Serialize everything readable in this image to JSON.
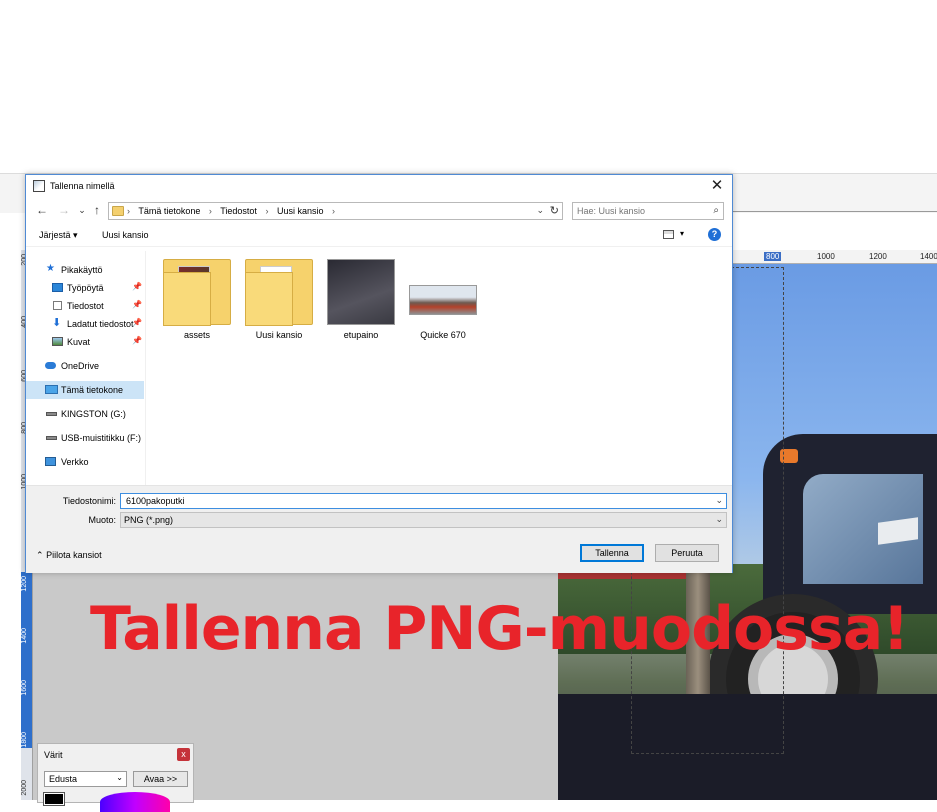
{
  "dialog": {
    "title": "Tallenna nimellä",
    "close_glyph": "✕",
    "nav": {
      "back": "←",
      "forward": "→",
      "recent": "⌄",
      "up": "↑"
    },
    "breadcrumbs": [
      "Tämä tietokone",
      "Tiedostot",
      "Uusi kansio"
    ],
    "crumb_separator": "›",
    "search_placeholder": "Hae: Uusi kansio",
    "toolbar": {
      "organize_label": "Järjestä ▾",
      "new_folder_label": "Uusi kansio",
      "help_label": "?"
    },
    "nav_pane": [
      {
        "label": "Pikakäyttö",
        "icon": "star-icon",
        "pinned": false
      },
      {
        "label": "Työpöytä",
        "icon": "desktop-icon",
        "pinned": true
      },
      {
        "label": "Tiedostot",
        "icon": "documents-icon",
        "pinned": true
      },
      {
        "label": "Ladatut tiedostot",
        "icon": "download-icon",
        "pinned": true
      },
      {
        "label": "Kuvat",
        "icon": "pictures-icon",
        "pinned": true
      },
      {
        "label": "OneDrive",
        "icon": "cloud-icon",
        "pinned": false
      },
      {
        "label": "Tämä tietokone",
        "icon": "computer-icon",
        "pinned": false,
        "selected": true
      },
      {
        "label": "KINGSTON (G:)",
        "icon": "drive-icon",
        "pinned": false
      },
      {
        "label": "USB-muistitikku (F:)",
        "icon": "usb-icon",
        "pinned": false
      },
      {
        "label": "Verkko",
        "icon": "network-icon",
        "pinned": false
      }
    ],
    "files": [
      {
        "name": "assets",
        "kind": "folder"
      },
      {
        "name": "Uusi kansio",
        "kind": "folder"
      },
      {
        "name": "etupaino",
        "kind": "image"
      },
      {
        "name": "Quicke 670",
        "kind": "image"
      }
    ],
    "filename_label": "Tiedostonimi:",
    "filename_value": "6100pakoputki",
    "filetype_label": "Muoto:",
    "filetype_value": "PNG (*.png)",
    "hide_folders_label": "Piilota kansiot",
    "save_button": "Tallenna",
    "cancel_button": "Peruuta"
  },
  "editor": {
    "ruler_top_labels": [
      "800",
      "1000",
      "1200",
      "1400"
    ],
    "ruler_left_labels": [
      "200",
      "400",
      "600",
      "800",
      "1000",
      "1200",
      "1400",
      "1600",
      "1800",
      "2000"
    ],
    "overlay_text": "Tallenna PNG-muodossa!",
    "colors_panel": {
      "title": "Värit",
      "close_glyph": "x",
      "mode_value": "Edusta",
      "more_button": "Avaa >>"
    }
  },
  "colors": {
    "accent": "#0078d7",
    "overlay_text": "#e8242a",
    "ruler_selection": "#2e6fcb"
  }
}
